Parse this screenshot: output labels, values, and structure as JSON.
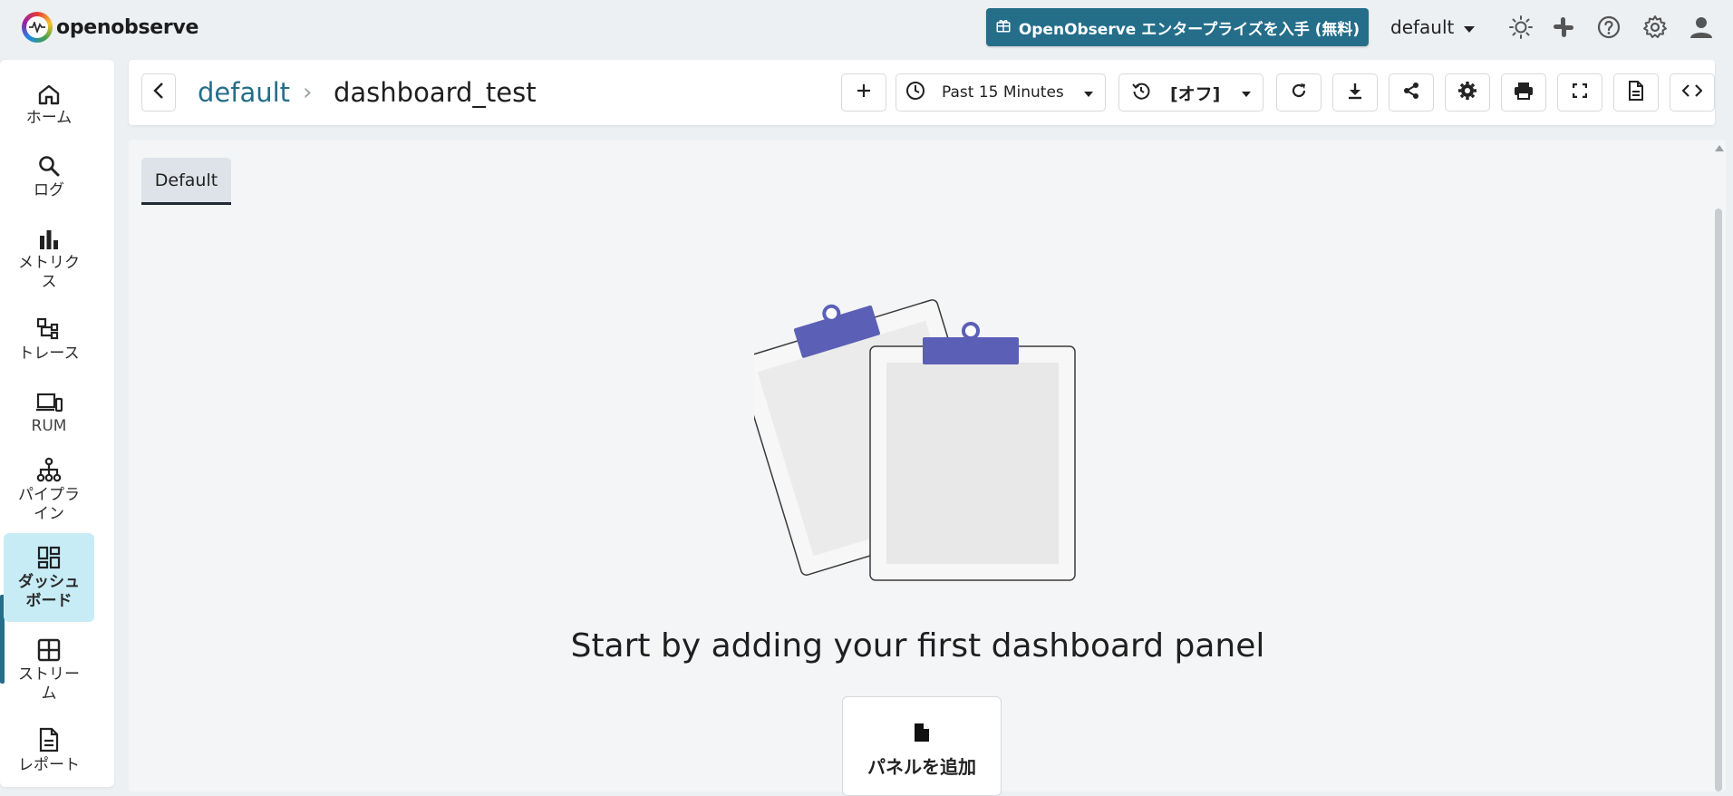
{
  "brand": {
    "name": "openobserve",
    "logo_icon": "openobserve-logo-icon"
  },
  "topbar": {
    "enterprise_label": "OpenObserve エンタープライズを入手 (無料)",
    "org": "default",
    "icons": [
      "theme-icon",
      "slack-icon",
      "help-icon",
      "settings-icon",
      "user-icon"
    ]
  },
  "sidebar": {
    "items": [
      {
        "label": "ホーム",
        "icon": "home-icon"
      },
      {
        "label": "ログ",
        "icon": "search-icon"
      },
      {
        "label": "メトリクス",
        "icon": "bar-chart-icon"
      },
      {
        "label": "トレース",
        "icon": "trace-icon"
      },
      {
        "label": "RUM",
        "icon": "devices-icon"
      },
      {
        "label": "パイプライン",
        "icon": "pipeline-icon"
      },
      {
        "label": "ダッシュボード",
        "icon": "dashboard-icon",
        "active": true
      },
      {
        "label": "ストリーム",
        "icon": "stream-grid-icon"
      },
      {
        "label": "レポート",
        "icon": "report-icon"
      }
    ]
  },
  "header": {
    "breadcrumb_folder": "default",
    "breadcrumb_separator": "›",
    "dashboard_name": "dashboard_test",
    "time_range": "Past 15 Minutes",
    "refresh_interval": "[オフ]"
  },
  "content": {
    "tab_label": "Default",
    "empty_message": "Start by adding your first dashboard panel",
    "add_panel_label": "パネルを追加"
  },
  "colors": {
    "accent": "#246e8a",
    "active_nav_bg": "#c7ecf5",
    "illustration": "#5b5fb6"
  }
}
